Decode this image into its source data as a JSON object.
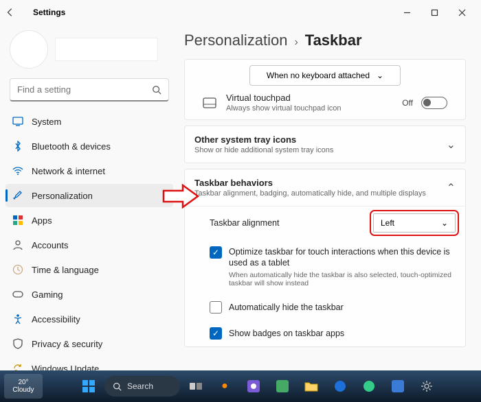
{
  "window": {
    "title": "Settings"
  },
  "search": {
    "placeholder": "Find a setting"
  },
  "sidebar": {
    "items": [
      {
        "label": "System"
      },
      {
        "label": "Bluetooth & devices"
      },
      {
        "label": "Network & internet"
      },
      {
        "label": "Personalization"
      },
      {
        "label": "Apps"
      },
      {
        "label": "Accounts"
      },
      {
        "label": "Time & language"
      },
      {
        "label": "Gaming"
      },
      {
        "label": "Accessibility"
      },
      {
        "label": "Privacy & security"
      },
      {
        "label": "Windows Update"
      }
    ]
  },
  "breadcrumb": {
    "parent": "Personalization",
    "current": "Taskbar"
  },
  "keyboard_dropdown": {
    "label": "When no keyboard attached"
  },
  "touchpad": {
    "title": "Virtual touchpad",
    "sub": "Always show virtual touchpad icon",
    "state": "Off"
  },
  "tray": {
    "title": "Other system tray icons",
    "sub": "Show or hide additional system tray icons"
  },
  "behaviors": {
    "title": "Taskbar behaviors",
    "sub": "Taskbar alignment, badging, automatically hide, and multiple displays",
    "alignment_label": "Taskbar alignment",
    "alignment_value": "Left",
    "optimize_label": "Optimize taskbar for touch interactions when this device is used as a tablet",
    "optimize_sub": "When automatically hide the taskbar is also selected, touch-optimized taskbar will show instead",
    "autohide_label": "Automatically hide the taskbar",
    "badges_label": "Show badges on taskbar apps"
  },
  "taskbar": {
    "search": "Search",
    "weather_temp": "20°",
    "weather_label": "Cloudy"
  }
}
